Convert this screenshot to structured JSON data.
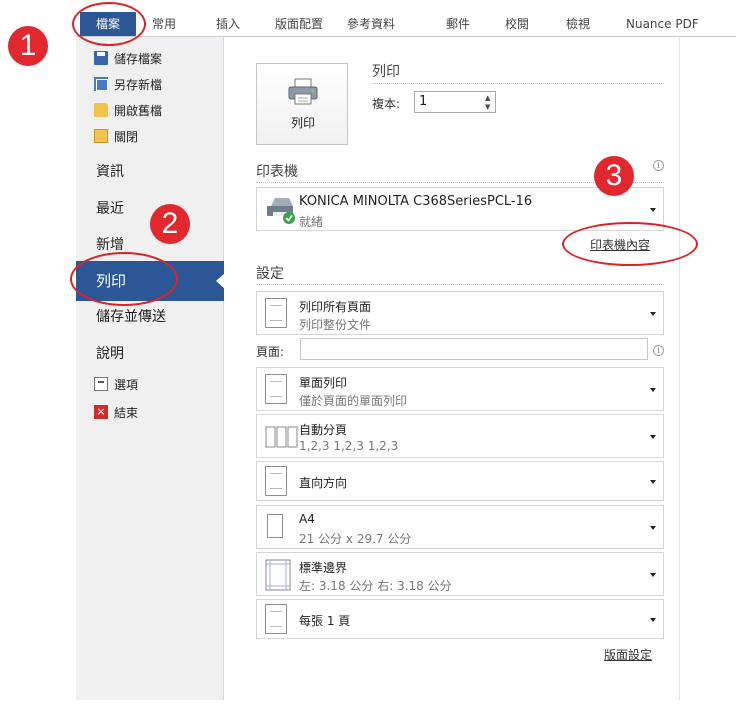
{
  "ribbon": {
    "tabs": [
      {
        "label": "檔案"
      },
      {
        "label": "常用"
      },
      {
        "label": "插入"
      },
      {
        "label": "版面配置"
      },
      {
        "label": "參考資料"
      },
      {
        "label": "郵件"
      },
      {
        "label": "校閱"
      },
      {
        "label": "檢視"
      },
      {
        "label": "Nuance PDF"
      }
    ]
  },
  "nav": {
    "quick": [
      {
        "label": "儲存檔案",
        "icon": "save-icon"
      },
      {
        "label": "另存新檔",
        "icon": "save-as-icon"
      },
      {
        "label": "開啟舊檔",
        "icon": "open-folder-icon"
      },
      {
        "label": "關閉",
        "icon": "close-folder-icon"
      }
    ],
    "items": [
      {
        "label": "資訊"
      },
      {
        "label": "最近"
      },
      {
        "label": "新增"
      },
      {
        "label": "列印"
      },
      {
        "label": "儲存並傳送"
      },
      {
        "label": "說明"
      }
    ],
    "footer": [
      {
        "label": "選項",
        "icon": "options-icon"
      },
      {
        "label": "結束",
        "icon": "exit-icon"
      }
    ]
  },
  "print": {
    "button_label": "列印",
    "title": "列印",
    "copies_label": "複本:",
    "copies_value": "1"
  },
  "printer": {
    "section_title": "印表機",
    "name": "KONICA MINOLTA C368SeriesPCL-16",
    "status": "就緒",
    "properties_link": "印表機內容"
  },
  "settings": {
    "section_title": "設定",
    "pages_label": "頁面:",
    "pages_value": "",
    "options": [
      {
        "line1": "列印所有頁面",
        "line2": "列印整份文件"
      },
      {
        "line1": "單面列印",
        "line2": "僅於頁面的單面列印"
      },
      {
        "line1": "自動分頁",
        "line2": "1,2,3    1,2,3    1,2,3"
      },
      {
        "line1": "直向方向",
        "line2": ""
      },
      {
        "line1": "A4",
        "line2": "21 公分 x 29.7 公分"
      },
      {
        "line1": "標準邊界",
        "line2": "左: 3.18 公分    右: 3.18 公分"
      },
      {
        "line1": "每張 1 頁",
        "line2": ""
      }
    ],
    "page_setup_link": "版面設定"
  },
  "annotations": {
    "badges": [
      "1",
      "2",
      "3"
    ],
    "color": "#e0282e"
  },
  "theme": {
    "accent": "#2b5797"
  }
}
